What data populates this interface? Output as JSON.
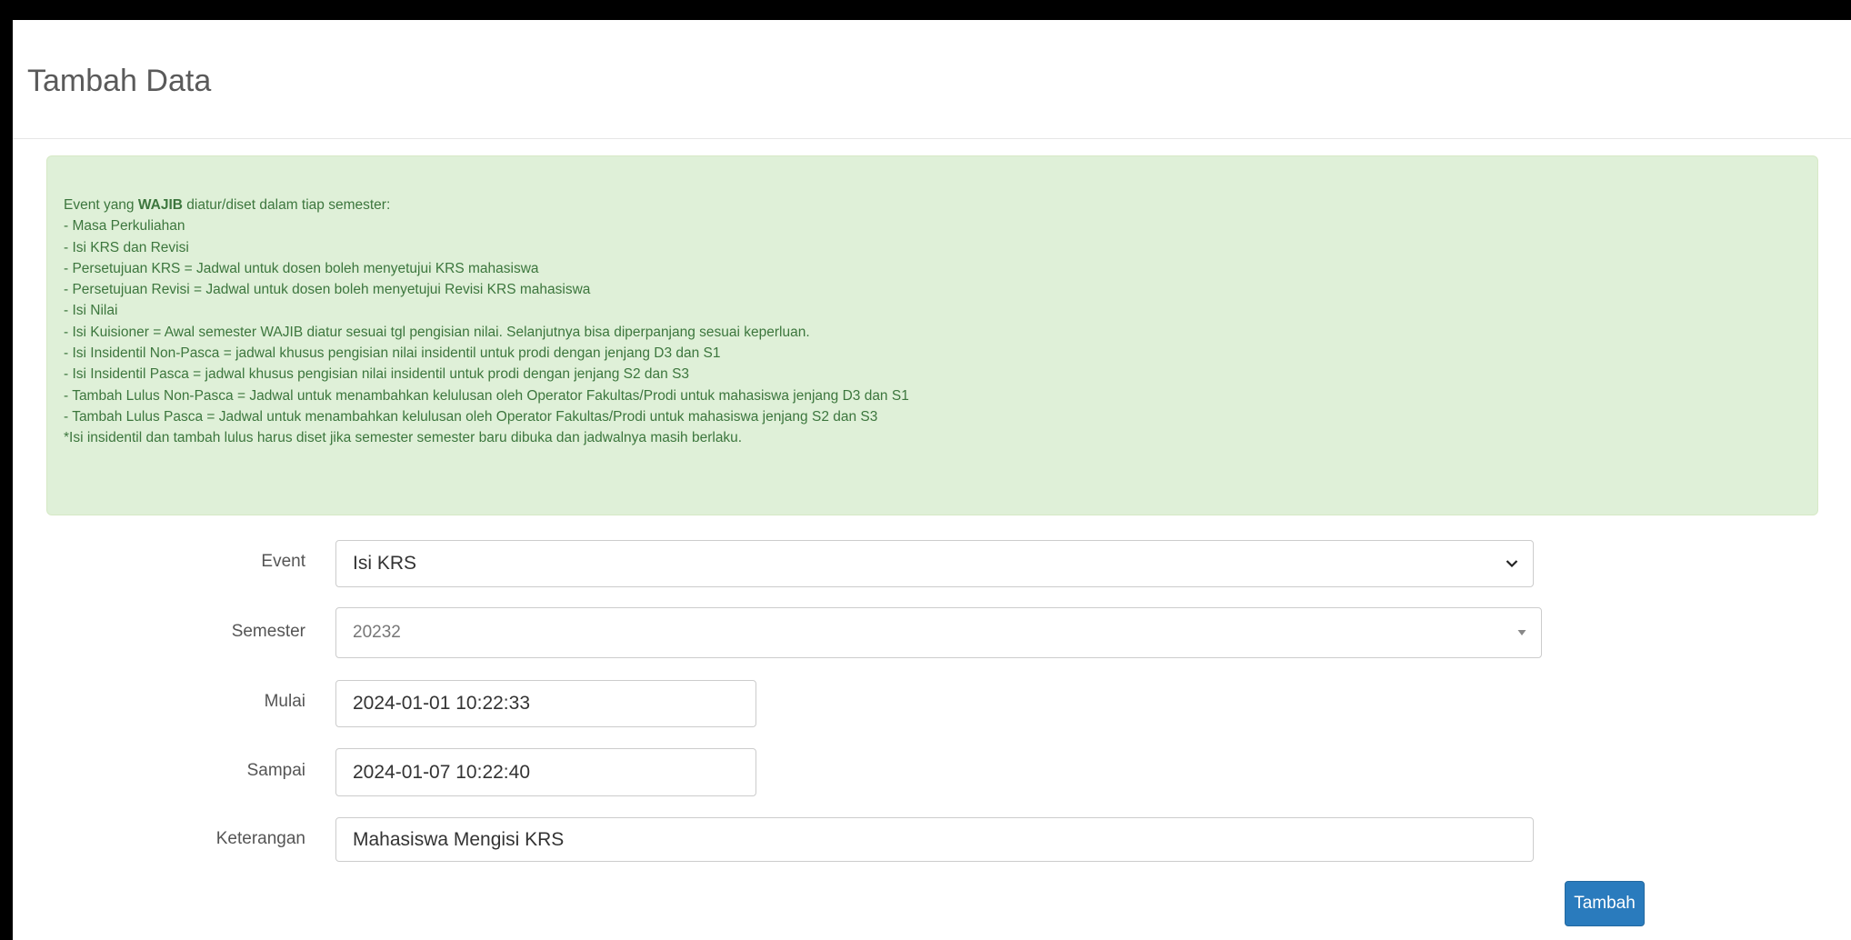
{
  "header": {
    "title": "Tambah Data"
  },
  "alert": {
    "intro_prefix": "Event yang ",
    "intro_bold": "WAJIB",
    "intro_suffix": " diatur/diset dalam tiap semester:",
    "lines": [
      "- Masa Perkuliahan",
      "- Isi KRS dan Revisi",
      "- Persetujuan KRS = Jadwal untuk dosen boleh menyetujui KRS mahasiswa",
      "- Persetujuan Revisi = Jadwal untuk dosen boleh menyetujui Revisi KRS mahasiswa",
      "- Isi Nilai",
      "- Isi Kuisioner = Awal semester WAJIB diatur sesuai tgl pengisian nilai. Selanjutnya bisa diperpanjang sesuai keperluan.",
      "- Isi Insidentil Non-Pasca = jadwal khusus pengisian nilai insidentil untuk prodi dengan jenjang D3 dan S1",
      "- Isi Insidentil Pasca = jadwal khusus pengisian nilai insidentil untuk prodi dengan jenjang S2 dan S3",
      "- Tambah Lulus Non-Pasca = Jadwal untuk menambahkan kelulusan oleh Operator Fakultas/Prodi untuk mahasiswa jenjang D3 dan S1",
      "- Tambah Lulus Pasca = Jadwal untuk menambahkan kelulusan oleh Operator Fakultas/Prodi untuk mahasiswa jenjang S2 dan S3",
      "*Isi insidentil dan tambah lulus harus diset jika semester semester baru dibuka dan jadwalnya masih berlaku."
    ]
  },
  "form": {
    "event": {
      "label": "Event",
      "value": "Isi KRS",
      "icon": "chevron-down-icon"
    },
    "semester": {
      "label": "Semester",
      "value": "20232",
      "icon": "caret-down-icon"
    },
    "mulai": {
      "label": "Mulai",
      "value": "2024-01-01 10:22:33"
    },
    "sampai": {
      "label": "Sampai",
      "value": "2024-01-07 10:22:40"
    },
    "keterangan": {
      "label": "Keterangan",
      "value": "Mahasiswa Mengisi KRS"
    },
    "submit_label": "Tambah"
  },
  "colors": {
    "alert_bg": "#dff0d8",
    "alert_text": "#3c763d",
    "button_bg": "#2a7bbd"
  }
}
